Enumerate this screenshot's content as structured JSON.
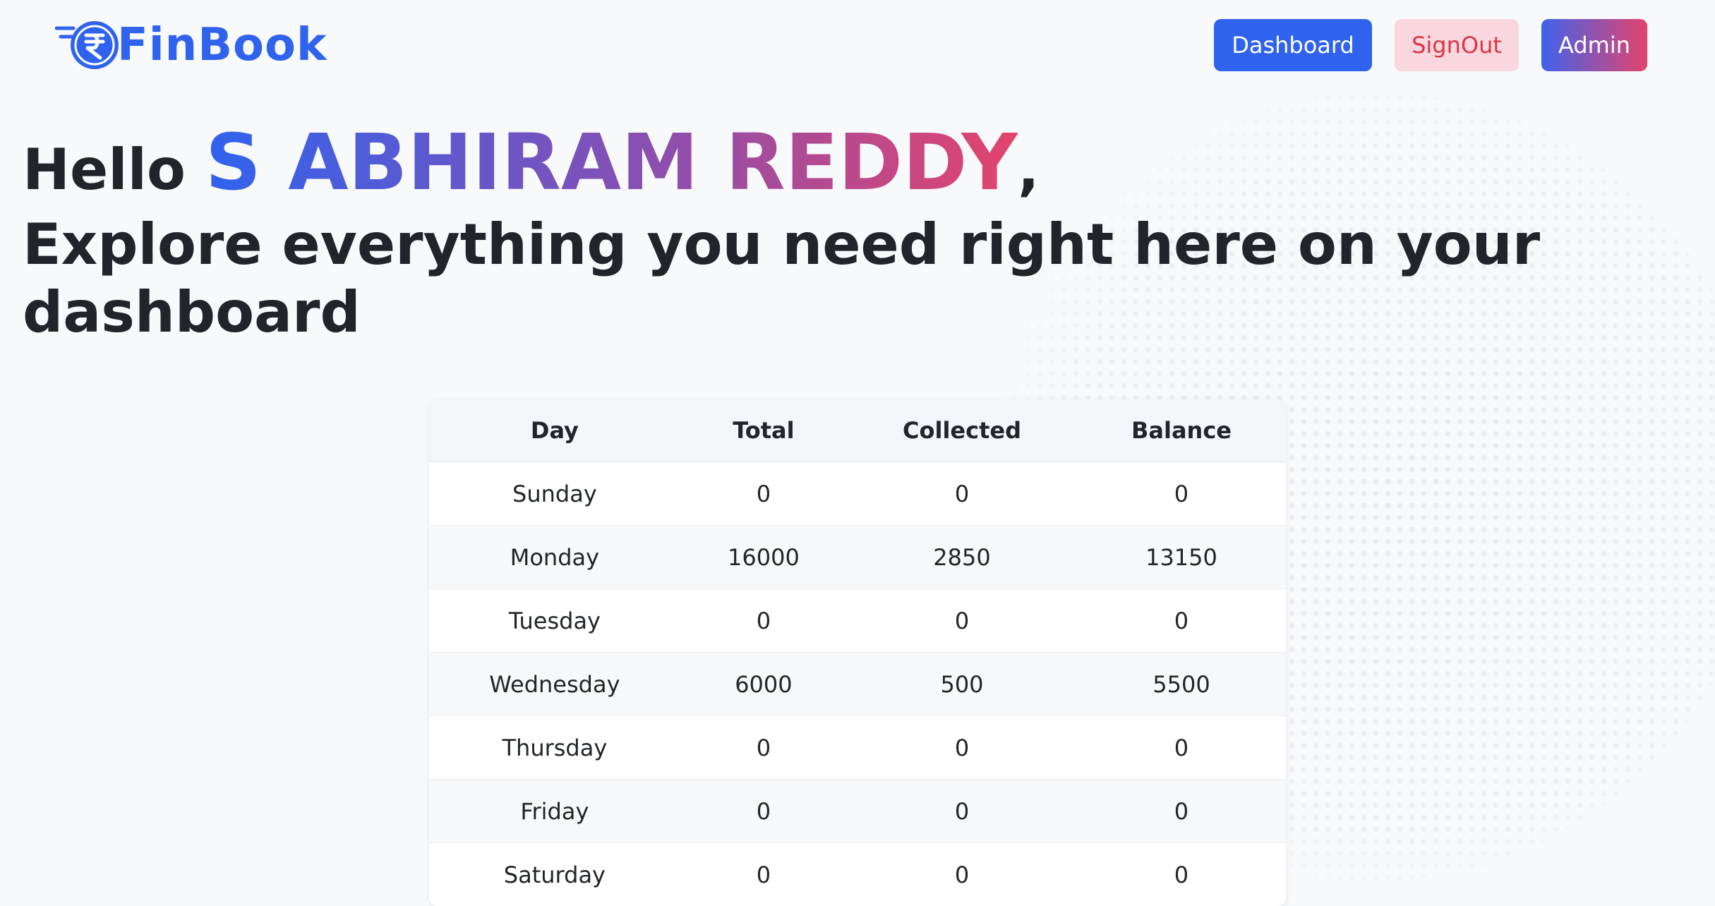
{
  "brand": {
    "name": "FinBook",
    "icon": "rupee-coin-icon",
    "color": "#2f63ee"
  },
  "nav": {
    "dashboard_label": "Dashboard",
    "signout_label": "SignOut",
    "admin_label": "Admin"
  },
  "hero": {
    "greeting": "Hello",
    "user_name": "S ABHIRAM REDDY",
    "comma": ",",
    "subtitle": "Explore everything you need right here on your dashboard"
  },
  "table": {
    "headers": [
      "Day",
      "Total",
      "Collected",
      "Balance"
    ],
    "rows": [
      [
        "Sunday",
        "0",
        "0",
        "0"
      ],
      [
        "Monday",
        "16000",
        "2850",
        "13150"
      ],
      [
        "Tuesday",
        "0",
        "0",
        "0"
      ],
      [
        "Wednesday",
        "6000",
        "500",
        "5500"
      ],
      [
        "Thursday",
        "0",
        "0",
        "0"
      ],
      [
        "Friday",
        "0",
        "0",
        "0"
      ],
      [
        "Saturday",
        "0",
        "0",
        "0"
      ]
    ]
  },
  "colors": {
    "primary": "#2f63ee",
    "danger": "#dc3545",
    "danger_soft": "#f8d7de",
    "gradient_start": "#3f63ec",
    "gradient_end": "#e3446d"
  },
  "decorations": {
    "background": "dotted-globe-illustration"
  }
}
